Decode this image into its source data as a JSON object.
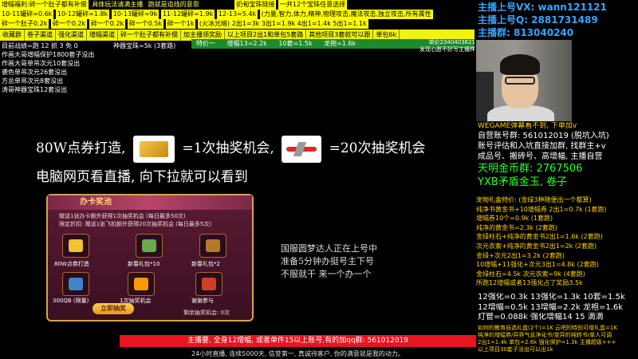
{
  "top_rows": [
    [
      "增幅福利:碎一个肚子都有补偿",
      "具体玩法请满主播",
      "跑就是追线的意思",
      "奶甸宝珠链接",
      "一共12个宝珠任意选择"
    ],
    [
      "10-11罐碎=0.6k",
      "10-12罐碎=1.8k",
      "10-13罐碎=9k",
      "11-12罐碎=1.9k",
      "12-13=5.4k",
      "(力量,智力,体力,精神,物理攻击,魔法攻击,独立攻击,所有属性"
    ],
    [
      "碎一个肚子0.2k",
      "碎一个0.2k",
      "碎一个0.2k",
      "碎一个0.5k",
      "碎一个1k",
      "(火冰光暗) 2出1=3k 3出1=1.9k 4出1=1.4k 5出1=1.1k"
    ]
  ],
  "tabs": [
    "收藏群",
    "卷子渠道",
    "强化渠道",
    "增幅渠道",
    "碎一个肚子都有补偿",
    "加主播领奖励",
    "以上项目2出1和单包5套路",
    "其他项目3套就可以跟",
    "单包6k"
  ],
  "green_bar": [
    "特价一",
    "增幅13=2.2k",
    "10套=1.5k",
    "龙袍=1.6k"
  ],
  "left_list": [
    "目前战绩=跑 12 抓 3 免 0",
    "神器宝珠=5k (3套路)",
    "作画大哥增幅保护1800套子没出",
    "作画大哥单吊次元10套没出",
    "袭色单吊次元26套没出",
    "方总单吊次元8套没出",
    "涛哥神器宝珠12套没出"
  ],
  "green_note": [
    "单价2340403621",
    "发现心愿不好写主播样"
  ],
  "right_top": {
    "vx": "主播上号VX: wann121121",
    "qq": "主播上号Q: 2881731489",
    "group": "主播群: 813040240"
  },
  "wegame": "WEGAME弹幕看不到, 下单加v",
  "self_account": "自营账号群: 561012019 (脱坑入坑)",
  "right_lines": [
    "账号评估和入坑直接加群, 找群主+v",
    "成品号、搬砖号、高增幅, 主播自营"
  ],
  "gold_group": "天明金币群: 2767506",
  "yxb": "YXB矛盾金玉, 卷子",
  "right_list": [
    "宠物礼盒特价: (金绿3种随便出一个都算)",
    "纯净书黄金书+10增幅券 2出1=0.7k (1套跑)",
    "增幅券10个=0.9k                   (1套跑)",
    "纯净的黄金书=2.3k                  (2套跑)",
    "金绿柱石+纯净的黄金书2出1=1.6k      (2套跑)",
    "次元衣索+纯净的黄金书2出1=2k        (2套跑)",
    "金绿+次元2出1=3.2k (2套跑)",
    "10增幅+11强化+次元3出1=4.8k         (2套跑)",
    "金绿柱石=4.5k 次元衣索=9k          (4套跑)",
    "所跑12增幅或者13强化占了奖励3.5k"
  ],
  "right_big": [
    "12强化=0.3k 13强化=1.3k  10套=1.5k",
    "12增幅=0.5k 13增幅=2.2k 龙袍=1.6k",
    "灯管=0.088k  强化增幅14 15 滴滴"
  ],
  "right_bottom": [
    "如何的教育自选礼盒(2个)=1K  云吧的特别可增礼盒=1K",
    "纯净的增幅券/异界气息净化书/变异的纯转书/单人可调",
    "2出1=1.4k  单包=2.6k  强化保护=1.3k  主播超级+++",
    "以上项目30套子没出可以出1k"
  ],
  "promo": {
    "line1_a": "80W点券打造,",
    "line1_b": "=1次抽奖机会,",
    "line1_c": "=20次抽奖机会",
    "line2": "电脑网页看直播, 向下拉就可以看到"
  },
  "card": {
    "title": "办卡奖池",
    "desc1": "赠送1张办卡额外获得1次抽奖机会 (每日最多50次)",
    "desc2": "限定折扣: 赠送1张飞机额外获得20次抽奖机会 (每日最多5次)",
    "items": [
      "80W点券打造",
      "新春礼包*10",
      "新春礼包*2",
      "300QB (限量)",
      "1次抽奖机会",
      "谢谢参与"
    ],
    "button": "立即抽奖",
    "remaining": "剩余抽奖机会: 0次"
  },
  "notice": [
    "国服圆梦达人正在上号中",
    "准备5分钟办挺号主下号",
    "不服就干 来一个办一个"
  ],
  "bottom_bar": "主播要, 全身12增幅, 或者单件15以上账号,有的加qq群: 561012019",
  "bottom_line": "24小时直播, 连续5000天, 信誉第一, 真诚待客户, 你的满意就是我的动力。",
  "colors": {
    "yellow": "#ffff00",
    "green": "#1d8a2c",
    "blue": "#33a6ff",
    "red": "#e8141f",
    "gold": "#ffd400"
  }
}
